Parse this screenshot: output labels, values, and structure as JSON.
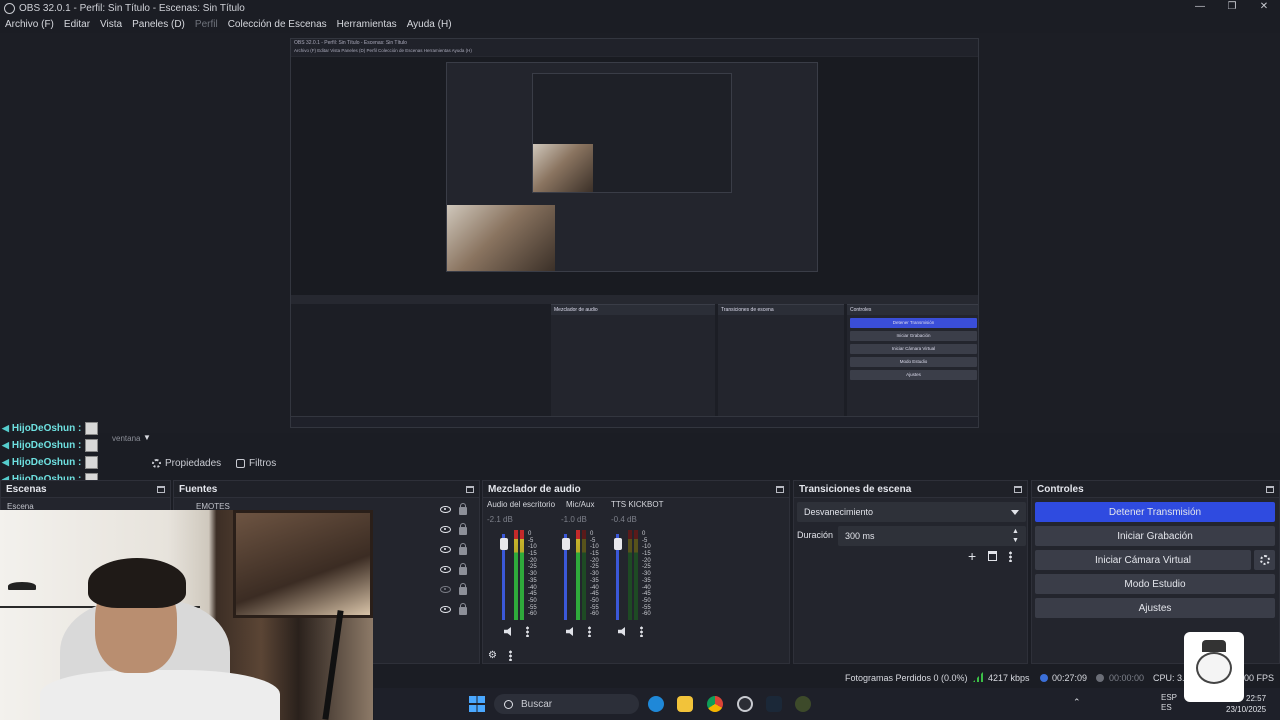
{
  "window": {
    "title": "OBS 32.0.1 - Perfil: Sin Título - Escenas: Sin Título",
    "controls": [
      "—",
      "❐",
      "✕"
    ]
  },
  "menu": {
    "items": [
      "Archivo (F)",
      "Editar",
      "Vista",
      "Paneles (D)",
      "Perfil",
      "Colección de Escenas",
      "Herramientas",
      "Ayuda (H)"
    ],
    "disabled_index": 4
  },
  "chat": {
    "lines": [
      {
        "user": "HijoDeOshun :"
      },
      {
        "user": "HijoDeOshun :"
      },
      {
        "user": "HijoDeOshun :"
      },
      {
        "user": "HijoDeOshun :"
      }
    ],
    "user_color": "#6ee0e0"
  },
  "source_bar": {
    "source_name": "ventana"
  },
  "toolbar": {
    "properties_label": "Propiedades",
    "filters_label": "Filtros"
  },
  "docks": {
    "scenes": {
      "title": "Escenas",
      "items": [
        "Escena"
      ]
    },
    "sources": {
      "title": "Fuentes",
      "items": [
        "EMOTES"
      ]
    },
    "mixer": {
      "title": "Mezclador de audio",
      "channels": [
        {
          "name": "Audio del escritorio",
          "db": "-2.1 dB",
          "fader": 0.92
        },
        {
          "name": "Mic/Aux",
          "db": "-1.0 dB",
          "fader": 0.92
        },
        {
          "name": "TTS KICKBOT",
          "db": "-0.4 dB",
          "fader": 0.92
        }
      ],
      "scale": [
        "0",
        "-5",
        "-10",
        "-15",
        "-20",
        "-25",
        "-30",
        "-35",
        "-40",
        "-45",
        "-50",
        "-55",
        "-60"
      ]
    },
    "transitions": {
      "title": "Transiciones de escena",
      "selected": "Desvanecimiento",
      "duration_label": "Duración",
      "duration_value": "300 ms"
    },
    "controls": {
      "title": "Controles",
      "buttons": [
        "Detener Transmisión",
        "Iniciar Grabación",
        "Iniciar Cámara Virtual",
        "Modo Estudio",
        "Ajustes"
      ],
      "accent": "#2f4be0"
    }
  },
  "status": {
    "dropped_frames": "Fotogramas Perdidos 0 (0.0%)",
    "bitrate": "4217 kbps",
    "stream_time": "00:27:09",
    "record_time": "00:00:00",
    "cpu": "CPU: 3.3",
    "fps": "00 FPS"
  },
  "taskbar": {
    "search_placeholder": "Buscar",
    "lang": "ESP",
    "lang_sub": "ES",
    "time": "22:57",
    "date": "23/10/2025"
  },
  "preview": {
    "inner_title": "OBS 32.0.1 - Perfil: Sin Título - Escenas: Sin Título",
    "inner_menu": "Archivo (F)   Editar   Vista   Paneles (D)   Perfil   Colección de Escenas   Herramientas   Ayuda (H)"
  }
}
